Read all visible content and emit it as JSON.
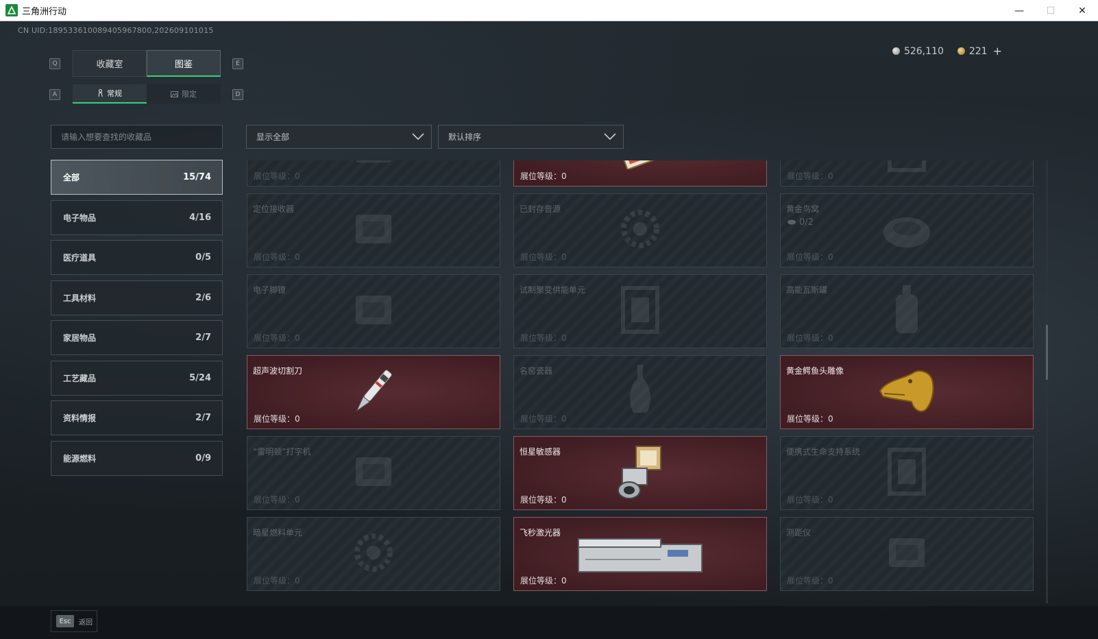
{
  "window": {
    "title": "三角洲行动",
    "minimize": "—",
    "maximize": "☐",
    "close": "✕"
  },
  "uid_text": "CN UID:18953361008940596780​0,202609101015",
  "currency": {
    "silver": "526,110",
    "gold": "221",
    "add": "+"
  },
  "tabs": {
    "key_left": "Q",
    "key_right": "E",
    "items": [
      {
        "label": "收藏室",
        "active": false
      },
      {
        "label": "图鉴",
        "active": true
      }
    ]
  },
  "subtabs": {
    "key_left": "A",
    "key_right": "D",
    "items": [
      {
        "label": "常规",
        "icon": "figure-icon",
        "active": true
      },
      {
        "label": "限定",
        "icon": "image-icon",
        "active": false
      }
    ]
  },
  "search": {
    "placeholder": "请输入想要查找的收藏品"
  },
  "filters": {
    "display": "显示全部",
    "sort": "默认排序"
  },
  "categories": [
    {
      "label": "全部",
      "count": "15/74",
      "active": true
    },
    {
      "label": "电子物品",
      "count": "4/16"
    },
    {
      "label": "医疗道具",
      "count": "0/5"
    },
    {
      "label": "工具材料",
      "count": "2/6"
    },
    {
      "label": "家居物品",
      "count": "2/7"
    },
    {
      "label": "工艺藏品",
      "count": "5/24"
    },
    {
      "label": "资料情报",
      "count": "2/7"
    },
    {
      "label": "能源燃料",
      "count": "0/9"
    }
  ],
  "level_label": "展位等级：0",
  "items": [
    {
      "name": "",
      "owned": false,
      "art": "device"
    },
    {
      "name": "",
      "owned": true,
      "art": "card"
    },
    {
      "name": "",
      "owned": false,
      "art": "frame"
    },
    {
      "name": "定位接收器",
      "owned": false,
      "art": "device"
    },
    {
      "name": "已封存音源",
      "owned": false,
      "art": "gear"
    },
    {
      "name": "黄金鸟窝",
      "owned": false,
      "art": "nest",
      "sub": "0/2"
    },
    {
      "name": "电子脚镣",
      "owned": false,
      "art": "device"
    },
    {
      "name": "试制聚变供能单元",
      "owned": false,
      "art": "frame"
    },
    {
      "name": "高能瓦斯罐",
      "owned": false,
      "art": "tank"
    },
    {
      "name": "超声波切割刀",
      "owned": true,
      "art": "knife"
    },
    {
      "name": "名窑瓷器",
      "owned": false,
      "art": "vase"
    },
    {
      "name": "黄金鳄鱼头雕像",
      "owned": true,
      "art": "gold-head"
    },
    {
      "name": "“雷明顿”打字机",
      "owned": false,
      "art": "device"
    },
    {
      "name": "恒星敏感器",
      "owned": true,
      "art": "sensor"
    },
    {
      "name": "便携式生命支持系统",
      "owned": false,
      "art": "frame"
    },
    {
      "name": "暗星燃料单元",
      "owned": false,
      "art": "gear"
    },
    {
      "name": "飞秒激光器",
      "owned": true,
      "art": "laser"
    },
    {
      "name": "测距仪",
      "owned": false,
      "art": "device"
    }
  ],
  "footer": {
    "esc_key": "Esc",
    "esc_label": "返回"
  },
  "colors": {
    "accent": "#3bd07a",
    "owned_card": "#452127",
    "locked_card": "#222a2f"
  }
}
